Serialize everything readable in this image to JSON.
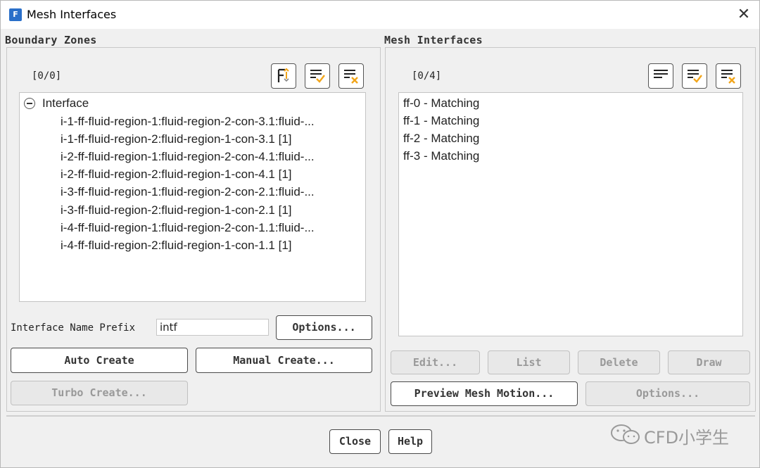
{
  "window": {
    "title": "Mesh Interfaces",
    "app_icon_letter": "F"
  },
  "boundary_zones": {
    "group_label": "Boundary Zones",
    "counter": "[0/0]",
    "tree_root": "Interface",
    "items": [
      "i-1-ff-fluid-region-1:fluid-region-2-con-3.1:fluid-...",
      "i-1-ff-fluid-region-2:fluid-region-1-con-3.1  [1]",
      "i-2-ff-fluid-region-1:fluid-region-2-con-4.1:fluid-...",
      "i-2-ff-fluid-region-2:fluid-region-1-con-4.1  [1]",
      "i-3-ff-fluid-region-1:fluid-region-2-con-2.1:fluid-...",
      "i-3-ff-fluid-region-2:fluid-region-1-con-2.1  [1]",
      "i-4-ff-fluid-region-1:fluid-region-2-con-1.1:fluid-...",
      "i-4-ff-fluid-region-2:fluid-region-1-con-1.1  [1]"
    ],
    "prefix_label": "Interface Name Prefix",
    "prefix_value": "intf",
    "options_button": "Options...",
    "auto_create_button": "Auto Create",
    "manual_create_button": "Manual Create...",
    "turbo_create_button": "Turbo Create..."
  },
  "mesh_interfaces": {
    "group_label": "Mesh Interfaces",
    "counter": "[0/4]",
    "items": [
      "ff-0 - Matching",
      "ff-1 - Matching",
      "ff-2 - Matching",
      "ff-3 - Matching"
    ],
    "edit_button": "Edit...",
    "list_button": "List",
    "delete_button": "Delete",
    "draw_button": "Draw",
    "preview_button": "Preview Mesh Motion...",
    "options_button": "Options..."
  },
  "footer": {
    "close_button": "Close",
    "help_button": "Help"
  },
  "watermark": {
    "text": "CFD小学生"
  },
  "icons": {
    "filter": "filter-list-icon",
    "select_all": "select-all-icon",
    "deselect_all": "deselect-all-icon",
    "close": "close-icon",
    "collapse": "tree-collapse-icon"
  },
  "colors": {
    "accent": "#f2a51a",
    "app_icon": "#2a6fc9"
  }
}
